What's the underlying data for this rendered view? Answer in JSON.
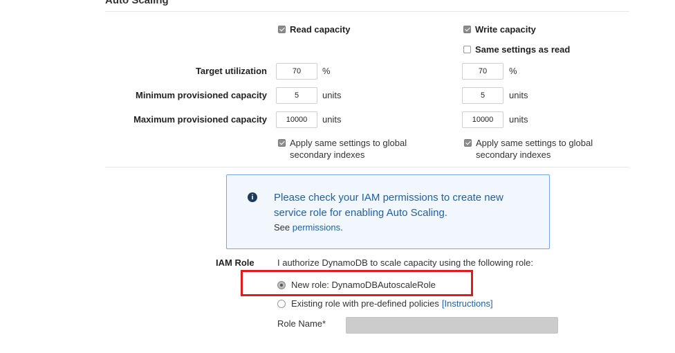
{
  "section": {
    "title": "Auto Scaling"
  },
  "read": {
    "label": "Read capacity",
    "checked": true
  },
  "write": {
    "label": "Write capacity",
    "checked": true
  },
  "same_settings": {
    "label": "Same settings as read",
    "checked": false
  },
  "rows": {
    "target": {
      "label": "Target utilization",
      "read_value": "70",
      "write_value": "70",
      "unit": "%"
    },
    "min": {
      "label": "Minimum provisioned capacity",
      "read_value": "5",
      "write_value": "5",
      "unit": "units"
    },
    "max": {
      "label": "Maximum provisioned capacity",
      "read_value": "10000",
      "write_value": "10000",
      "unit": "units"
    }
  },
  "gsi": {
    "read": {
      "line1": "Apply same settings to global",
      "line2": "secondary indexes",
      "checked": true
    },
    "write": {
      "line1": "Apply same settings to global",
      "line2": "secondary indexes",
      "checked": true
    }
  },
  "info": {
    "message": "Please check your IAM permissions to create new service role for enabling Auto Scaling.",
    "see_prefix": "See",
    "link": "permissions",
    "see_suffix": ".",
    "icon": "info-icon"
  },
  "iam": {
    "label": "IAM Role",
    "description": "I authorize DynamoDB to scale capacity using the following role:",
    "new_role": {
      "label": "New role: DynamoDBAutoscaleRole",
      "selected": true
    },
    "existing_role": {
      "label": "Existing role with pre-defined policies",
      "link": "[Instructions]",
      "selected": false
    },
    "role_name": {
      "label": "Role Name*",
      "value": ""
    }
  },
  "colors": {
    "link": "#1f5fa8",
    "info_border": "#6fa8dc",
    "info_bg": "#f1f7fd",
    "highlight": "#e01b1b"
  }
}
